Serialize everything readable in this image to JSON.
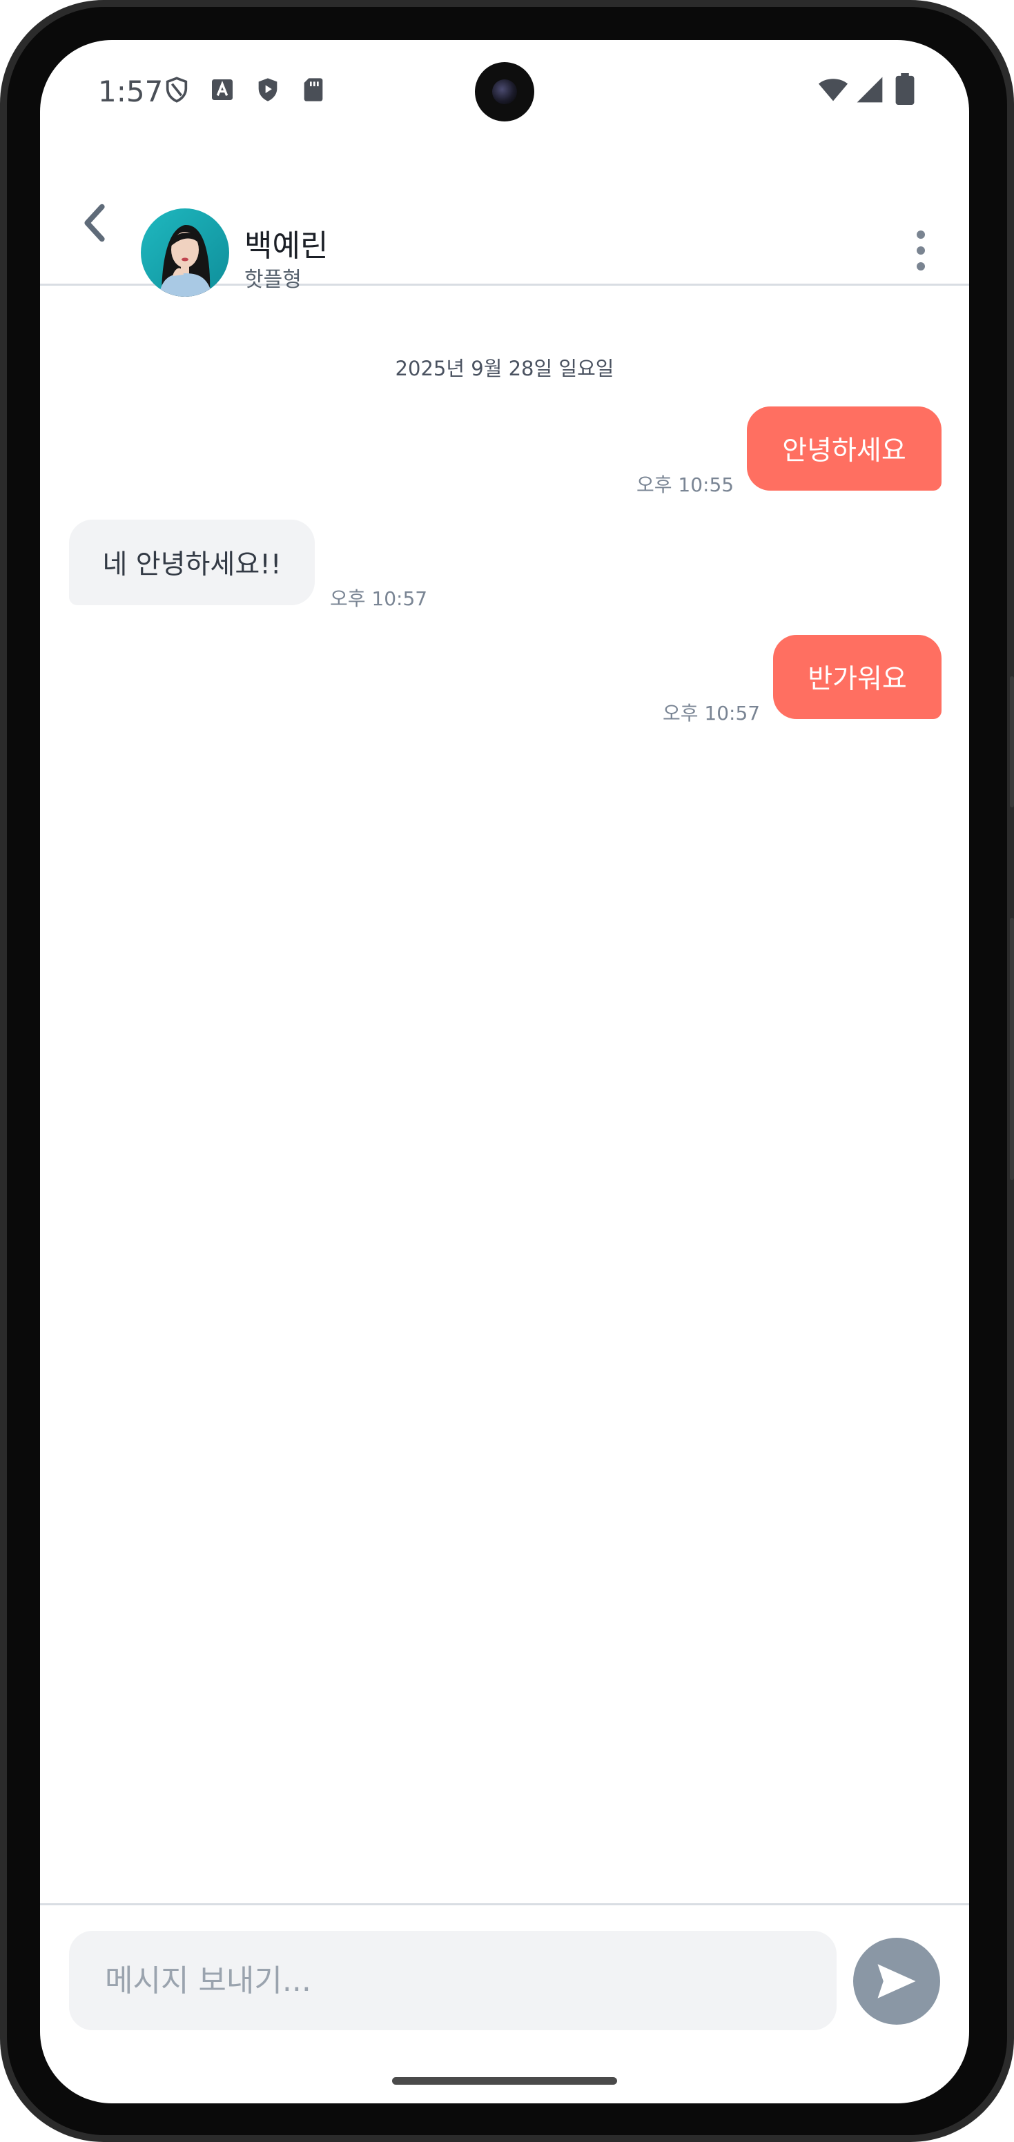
{
  "status_bar": {
    "time": "1:57",
    "left_icons": [
      "shield-outline-icon",
      "font-a-icon",
      "play-shield-icon",
      "sd-card-icon"
    ],
    "right_icons": [
      "wifi-icon",
      "cell-signal-icon",
      "battery-icon"
    ]
  },
  "header": {
    "contact_name": "백예린",
    "contact_subtitle": "핫플형",
    "icons": [
      "chevron-left-icon",
      "avatar",
      "more-vert-icon"
    ]
  },
  "chat": {
    "date_separator": "2025년 9월 28일 일요일",
    "messages": [
      {
        "direction": "outgoing",
        "text": "안녕하세요",
        "time": "오후 10:55"
      },
      {
        "direction": "incoming",
        "text": "네 안녕하세요!!",
        "time": "오후 10:57"
      },
      {
        "direction": "outgoing",
        "text": "반가워요",
        "time": "오후 10:57"
      }
    ]
  },
  "composer": {
    "placeholder": "메시지 보내기...",
    "value": "",
    "send_icon": "send-icon"
  },
  "colors": {
    "outgoing_bubble": "#ff6f61",
    "incoming_bubble": "#f2f3f5",
    "send_button": "#8a97a5",
    "divider": "#d9dde3"
  }
}
